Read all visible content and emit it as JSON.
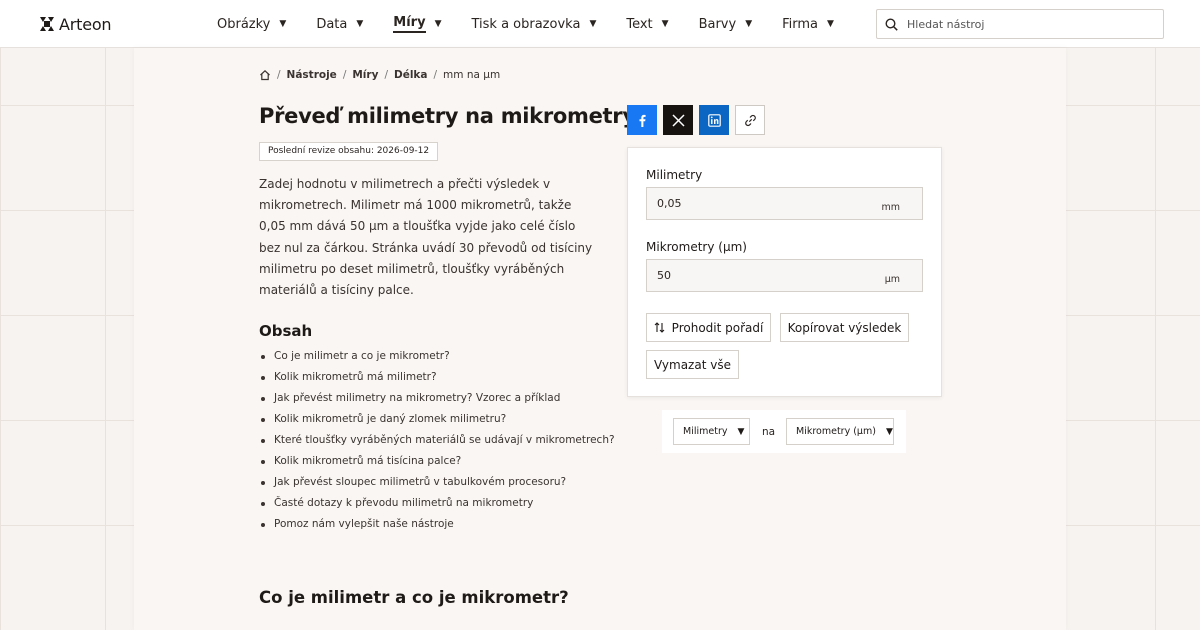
{
  "brand": {
    "name": "Arteon"
  },
  "nav": {
    "items": [
      {
        "label": "Obrázky",
        "active": false
      },
      {
        "label": "Data",
        "active": false
      },
      {
        "label": "Míry",
        "active": true
      },
      {
        "label": "Tisk a obrazovka",
        "active": false
      },
      {
        "label": "Text",
        "active": false
      },
      {
        "label": "Barvy",
        "active": false
      },
      {
        "label": "Firma",
        "active": false
      }
    ],
    "caret": "▼"
  },
  "search": {
    "placeholder": "Hledat nástroj",
    "value": ""
  },
  "breadcrumb": {
    "separator": "/",
    "items": [
      "Nástroje",
      "Míry",
      "Délka"
    ],
    "current": "mm na µm"
  },
  "page": {
    "title": "Převeď milimetry na mikrometry",
    "revision": "Poslední revize obsahu: 2026-09-12",
    "intro": "Zadej hodnotu v milimetrech a přečti výsledek v mikrometrech. Milimetr má 1000 mikrometrů, takže 0,05 mm dává 50 µm a tloušťka vyjde jako celé číslo bez nul za čárkou. Stránka uvádí 30 převodů od tisíciny milimetru po deset milimetrů, tloušťky vyráběných materiálů a tisíciny palce."
  },
  "toc": {
    "title": "Obsah",
    "items": [
      "Co je milimetr a co je mikrometr?",
      "Kolik mikrometrů má milimetr?",
      "Jak převést milimetry na mikrometry? Vzorec a příklad",
      "Kolik mikrometrů je daný zlomek milimetru?",
      "Které tloušťky vyráběných materiálů se udávají v mikrometrech?",
      "Kolik mikrometrů má tisícina palce?",
      "Jak převést sloupec milimetrů v tabulkovém procesoru?",
      "Časté dotazy k převodu milimetrů na mikrometry",
      "Pomoz nám vylepšit naše nástroje"
    ]
  },
  "section": {
    "heading": "Co je milimetr a co je mikrometr?"
  },
  "share": {
    "icons": [
      "facebook-icon",
      "x-icon",
      "linkedin-icon",
      "link-icon"
    ]
  },
  "converter": {
    "from_label": "Milimetry",
    "from_value": "0,05",
    "from_unit": "mm",
    "to_label": "Mikrometry (µm)",
    "to_value": "50",
    "to_unit": "µm",
    "swap_label": "Prohodit pořadí",
    "copy_label": "Kopírovat výsledek",
    "clear_label": "Vymazat vše"
  },
  "unit_selector": {
    "from": "Milimetry",
    "joiner": "na",
    "to": "Mikrometry (µm)",
    "caret": "▼"
  },
  "colors": {
    "facebook": "#1877f2",
    "x": "#171311",
    "linkedin": "#0a66c2",
    "background": "#f7f3f0"
  }
}
